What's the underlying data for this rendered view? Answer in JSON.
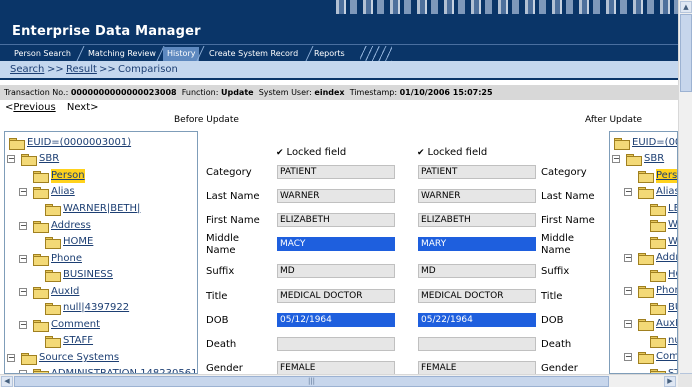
{
  "app": {
    "title": "Enterprise Data Manager"
  },
  "nav": {
    "tabs": [
      {
        "label": "Person Search",
        "active": false
      },
      {
        "label": "Matching Review",
        "active": false
      },
      {
        "label": "History",
        "active": true
      },
      {
        "label": "Create System Record",
        "active": false
      },
      {
        "label": "Reports",
        "active": false
      }
    ]
  },
  "breadcrumb": {
    "search": "Search",
    "sep1": ">>",
    "result": "Result",
    "sep2": ">>",
    "current": "Comparison"
  },
  "transaction": {
    "no_label": "Transaction No.:",
    "no_value": "0000000000000023008",
    "function_label": "Function:",
    "function_value": "Update",
    "user_label": "System User:",
    "user_value": "eindex",
    "timestamp_label": "Timestamp:",
    "timestamp_value": "01/10/2006 15:07:25"
  },
  "pager": {
    "previous": "Previous",
    "next": "Next>",
    "prev_prefix": "<"
  },
  "panels": {
    "before_label": "Before Update",
    "after_label": "After Update"
  },
  "tree_left": [
    {
      "text": "EUID=(0000003001)",
      "toggle": "",
      "selected": false
    },
    {
      "text": "SBR",
      "toggle": "−",
      "selected": false
    },
    {
      "text": "Person",
      "toggle": "",
      "selected": true
    },
    {
      "text": "Alias",
      "toggle": "−",
      "selected": false
    },
    {
      "text": "WARNER|BETH|",
      "toggle": "",
      "selected": false
    },
    {
      "text": "Address",
      "toggle": "−",
      "selected": false
    },
    {
      "text": "HOME",
      "toggle": "",
      "selected": false
    },
    {
      "text": "Phone",
      "toggle": "−",
      "selected": false
    },
    {
      "text": "BUSINESS",
      "toggle": "",
      "selected": false
    },
    {
      "text": "AuxId",
      "toggle": "−",
      "selected": false
    },
    {
      "text": "null|4397922",
      "toggle": "",
      "selected": false
    },
    {
      "text": "Comment",
      "toggle": "−",
      "selected": false
    },
    {
      "text": "STAFF",
      "toggle": "",
      "selected": false
    },
    {
      "text": "Source Systems",
      "toggle": "−",
      "selected": false
    },
    {
      "text": "ADMINISTRATION 148230561",
      "toggle": "−",
      "selected": false
    }
  ],
  "tree_right": [
    {
      "text": "EUID=(000",
      "toggle": "",
      "selected": false
    },
    {
      "text": "SBR",
      "toggle": "−",
      "selected": false
    },
    {
      "text": "Person",
      "toggle": "",
      "selected": true
    },
    {
      "text": "Alias",
      "toggle": "−",
      "selected": false
    },
    {
      "text": "LE",
      "toggle": "",
      "selected": false
    },
    {
      "text": "WA",
      "toggle": "",
      "selected": false
    },
    {
      "text": "WA",
      "toggle": "",
      "selected": false
    },
    {
      "text": "Addre",
      "toggle": "−",
      "selected": false
    },
    {
      "text": "HO",
      "toggle": "",
      "selected": false
    },
    {
      "text": "Phone",
      "toggle": "−",
      "selected": false
    },
    {
      "text": "BU",
      "toggle": "",
      "selected": false
    },
    {
      "text": "AuxId",
      "toggle": "−",
      "selected": false
    },
    {
      "text": "nu",
      "toggle": "",
      "selected": false
    },
    {
      "text": "Comm",
      "toggle": "−",
      "selected": false
    },
    {
      "text": "ST",
      "toggle": "",
      "selected": false
    }
  ],
  "form": {
    "locked_label": "Locked field",
    "rows": [
      {
        "label": "Category",
        "before": "PATIENT",
        "after": "PATIENT",
        "changed": false
      },
      {
        "label": "Last Name",
        "before": "WARNER",
        "after": "WARNER",
        "changed": false
      },
      {
        "label": "First Name",
        "before": "ELIZABETH",
        "after": "ELIZABETH",
        "changed": false
      },
      {
        "label_line1": "Middle",
        "label_line2": "Name",
        "label": "Middle Name",
        "before": "MACY",
        "after": "MARY",
        "changed": true
      },
      {
        "label": "Suffix",
        "before": "MD",
        "after": "MD",
        "changed": false
      },
      {
        "label": "Title",
        "before": "MEDICAL DOCTOR",
        "after": "MEDICAL DOCTOR",
        "changed": false
      },
      {
        "label": "DOB",
        "before": "05/12/1964",
        "after": "05/22/1964",
        "changed": true
      },
      {
        "label": "Death",
        "before": "",
        "after": "",
        "changed": false
      },
      {
        "label": "Gender",
        "before": "FEMALE",
        "after": "FEMALE",
        "changed": false
      }
    ]
  },
  "colors": {
    "header_bg": "#0a3568",
    "changed_field": "#1e5fde",
    "selected_node": "#ffd21c",
    "crumb_bar": "#c4d7ee"
  },
  "icons": {
    "tree_node": "folder-icon",
    "lock": "check-icon"
  }
}
